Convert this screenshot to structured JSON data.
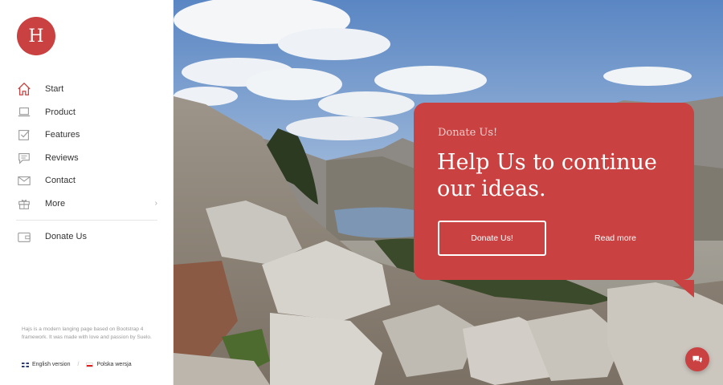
{
  "brand": {
    "logo_letter": "H",
    "accent": "#c94141"
  },
  "nav": {
    "items": [
      {
        "label": "Start",
        "icon": "home-icon"
      },
      {
        "label": "Product",
        "icon": "laptop-icon"
      },
      {
        "label": "Features",
        "icon": "checklist-icon"
      },
      {
        "label": "Reviews",
        "icon": "chat-bubble-icon"
      },
      {
        "label": "Contact",
        "icon": "envelope-icon"
      },
      {
        "label": "More",
        "icon": "gift-icon",
        "has_submenu": true
      }
    ],
    "secondary": [
      {
        "label": "Donate Us",
        "icon": "wallet-icon"
      }
    ]
  },
  "footer": {
    "about": "Hajs is a modern langing page based on Bootstrap 4 framework. It was made with love and passion by Suelo.",
    "languages": [
      {
        "label": "English version",
        "flag": "uk-flag-icon"
      },
      {
        "label": "Polska wersja",
        "flag": "pl-flag-icon"
      }
    ]
  },
  "hero_card": {
    "eyebrow": "Donate Us!",
    "headline": "Help Us to continue our ideas.",
    "primary_button": "Donate Us!",
    "secondary_link": "Read more"
  },
  "chat_button": {
    "icon": "chat-icon"
  }
}
